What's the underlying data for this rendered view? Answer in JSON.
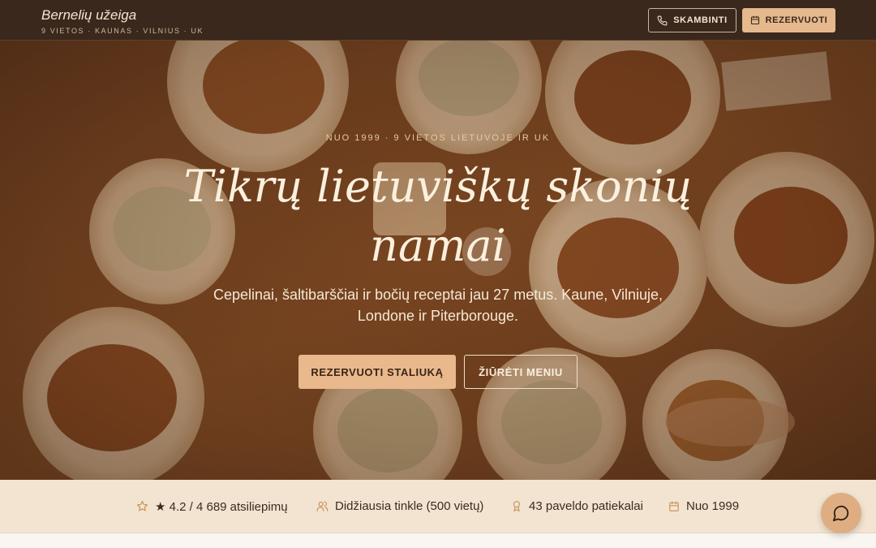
{
  "header": {
    "brand_name": "Bernelių užeiga",
    "brand_sub": "9 VIETOS · KAUNAS · VILNIUS · UK",
    "call_label": "SKAMBINTI",
    "reserve_label": "REZERVUOTI"
  },
  "hero": {
    "eyebrow": "NUO 1999 · 9 VIETOS LIETUVOJE IR UK",
    "headline": "Tikrų lietuviškų skonių namai",
    "lead": "Cepelinai, šaltibarščiai ir bočių receptai jau 27 metus. Kaune, Vilniuje, Londone ir Piterborouge.",
    "cta_primary": "REZERVUOTI STALIUKĄ",
    "cta_secondary": "ŽIŪRĖTI MENIU"
  },
  "stats": [
    {
      "icon": "star-outline-icon",
      "text": "★ 4.2 / 4 689 atsiliepimų"
    },
    {
      "icon": "users-icon",
      "text": "Didžiausia tinkle (500 vietų)"
    },
    {
      "icon": "award-icon",
      "text": "43 paveldo patiekalai"
    },
    {
      "icon": "calendar-icon",
      "text": "Nuo 1999"
    }
  ],
  "colors": {
    "header_bg": "#3a281d",
    "accent": "#e5b88d",
    "stats_bg": "#f2e4d1",
    "chat_button": "#deae82"
  }
}
